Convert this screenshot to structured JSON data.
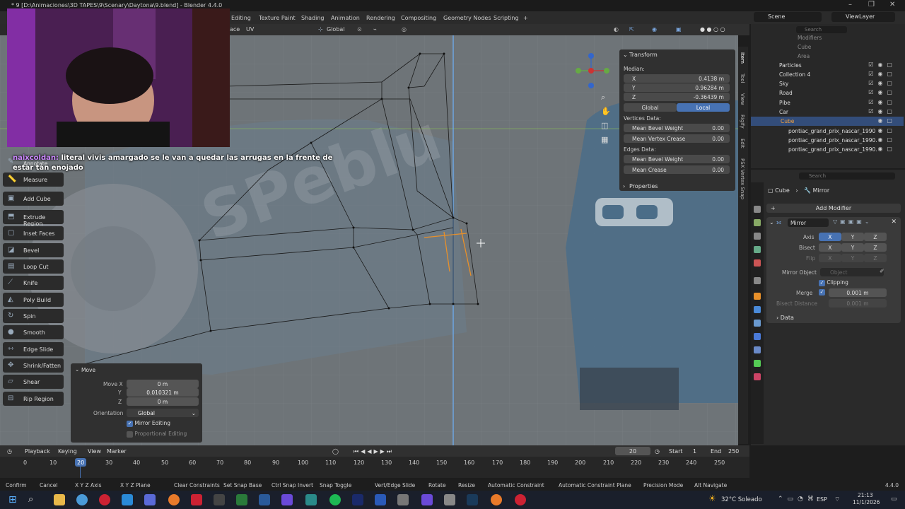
{
  "title_bar": {
    "title": "* 9 [D:\\Animaciones\\3D TAPES\\9\\Scenary\\Daytona\\9.blend] - Blender 4.4.0"
  },
  "workspace_tabs": [
    "Editing",
    "Texture Paint",
    "Shading",
    "Animation",
    "Rendering",
    "Compositing",
    "Geometry Nodes",
    "Scripting"
  ],
  "scene": {
    "name": "Scene",
    "view_layer": "ViewLayer"
  },
  "viewport_header": {
    "uv": "UV",
    "face": "ace",
    "orientation": "Global"
  },
  "chat": {
    "user": "naixcoldan:",
    "message": "literal vivis amargado se le van a quedar las arrugas en la frente de estar tan enojado"
  },
  "toolbar": {
    "annotate": "Annotate",
    "tools": [
      "Measure",
      "Add Cube",
      "Extrude Region",
      "Inset Faces",
      "Bevel",
      "Loop Cut",
      "Knife",
      "Poly Build",
      "Spin",
      "Smooth",
      "Edge Slide",
      "Shrink/Fatten",
      "Shear",
      "Rip Region"
    ]
  },
  "npanel": {
    "title": "Transform",
    "median": "Median:",
    "x": {
      "k": "X",
      "v": "0.4138 m"
    },
    "y": {
      "k": "Y",
      "v": "0.96284 m"
    },
    "z": {
      "k": "Z",
      "v": "-0.36439 m"
    },
    "global": "Global",
    "local": "Local",
    "vertices_data": "Vertices Data:",
    "mean_bevel_weight": {
      "k": "Mean Bevel Weight",
      "v": "0.00"
    },
    "mean_vertex_crease": {
      "k": "Mean Vertex Crease",
      "v": "0.00"
    },
    "edges_data": "Edges Data:",
    "edge_bevel_weight": {
      "k": "Mean Bevel Weight",
      "v": "0.00"
    },
    "mean_crease": {
      "k": "Mean Crease",
      "v": "0.00"
    },
    "properties": "Properties"
  },
  "side_tabs": [
    "Item",
    "Tool",
    "View",
    "Rigify",
    "Edit",
    "PSX Vertex Snap"
  ],
  "move_panel": {
    "title": "Move",
    "move_x_label": "Move X",
    "move_x": "0 m",
    "y_label": "Y",
    "y": "0.010321 m",
    "z_label": "Z",
    "z": "0 m",
    "orientation_label": "Orientation",
    "orientation": "Global",
    "mirror_editing": "Mirror Editing",
    "proportional_editing": "Proportional Editing"
  },
  "outliner": {
    "search_placeholder": "Search",
    "rows": [
      "Modifiers",
      "Cube",
      "Area",
      "Particles",
      "Collection 4",
      "Sky",
      "Road",
      "Pibe",
      "Car",
      "Cube",
      "pontiac_grand_prix_nascar_1990",
      "pontiac_grand_prix_nascar_1990.",
      "pontiac_grand_prix_nascar_1990."
    ]
  },
  "properties": {
    "search_placeholder": "Search",
    "breadcrumb_object": "Cube",
    "breadcrumb_modifier": "Mirror",
    "add_modifier": "Add Modifier",
    "modifier_name": "Mirror",
    "axis_label": "Axis",
    "bisect_label": "Bisect",
    "flip_label": "Flip",
    "x": "X",
    "y": "Y",
    "z": "Z",
    "mirror_object_label": "Mirror Object",
    "mirror_object_placeholder": "Object",
    "clipping": "Clipping",
    "merge_label": "Merge",
    "merge_value": "0.001 m",
    "bisect_distance_label": "Bisect Distance",
    "bisect_distance_value": "0.001 m",
    "data": "Data"
  },
  "timeline": {
    "playback": "Playback",
    "keying": "Keying",
    "view": "View",
    "marker": "Marker",
    "current_frame": "20",
    "start_label": "Start",
    "start": "1",
    "end_label": "End",
    "end": "250",
    "ticks": [
      "0",
      "10",
      "20",
      "30",
      "40",
      "50",
      "60",
      "70",
      "80",
      "90",
      "100",
      "110",
      "120",
      "130",
      "140",
      "150",
      "160",
      "170",
      "180",
      "190",
      "200",
      "210",
      "220",
      "230",
      "240",
      "250"
    ]
  },
  "statusbar": {
    "items": [
      "Confirm",
      "Cancel",
      "X Y Z Axis",
      "X Y Z Plane",
      "Clear Constraints",
      "Set Snap Base",
      "Ctrl Snap Invert",
      "Snap Toggle",
      "Vert/Edge Slide",
      "Rotate",
      "Resize",
      "Automatic Constraint",
      "Automatic Constraint Plane",
      "Precision Mode",
      "Alt Navigate"
    ],
    "version": "4.4.0"
  },
  "taskbar": {
    "weather": "32°C Soleado",
    "lang": "ESP",
    "time": "21:13",
    "date": "11/1/2026"
  },
  "colors": {
    "accent": "#4772b3",
    "selected": "#e8902a",
    "viewport_bg": "#6e7478"
  }
}
